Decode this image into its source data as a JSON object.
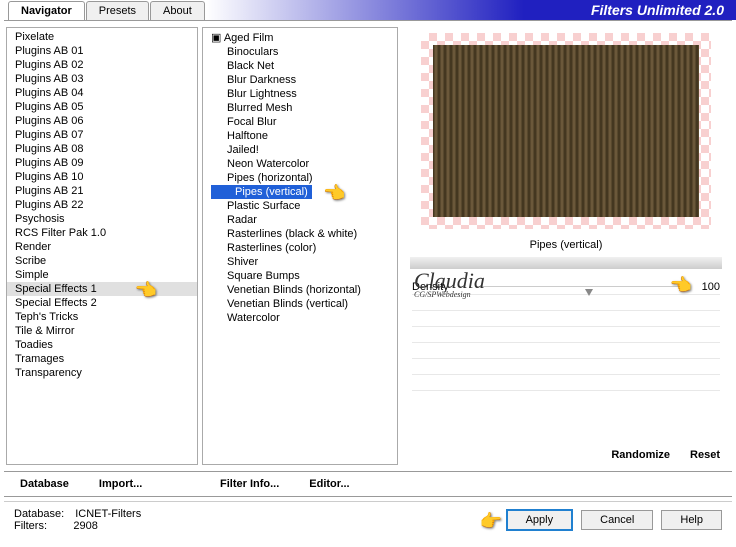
{
  "app_title": "Filters Unlimited 2.0",
  "tabs": [
    "Navigator",
    "Presets",
    "About"
  ],
  "active_tab": 0,
  "categories": [
    "Pixelate",
    "Plugins AB 01",
    "Plugins AB 02",
    "Plugins AB 03",
    "Plugins AB 04",
    "Plugins AB 05",
    "Plugins AB 06",
    "Plugins AB 07",
    "Plugins AB 08",
    "Plugins AB 09",
    "Plugins AB 10",
    "Plugins AB 21",
    "Plugins AB 22",
    "Psychosis",
    "RCS Filter Pak 1.0",
    "Render",
    "Scribe",
    "Simple",
    "Special Effects 1",
    "Special Effects 2",
    "Teph's Tricks",
    "Tile & Mirror",
    "Toadies",
    "Tramages",
    "Transparency"
  ],
  "selected_category_index": 18,
  "filters_header": "Aged Film",
  "filters": [
    "Binoculars",
    "Black Net",
    "Blur Darkness",
    "Blur Lightness",
    "Blurred Mesh",
    "Focal Blur",
    "Halftone",
    "Jailed!",
    "Neon Watercolor",
    "Pipes (horizontal)",
    "Pipes (vertical)",
    "Plastic Surface",
    "Radar",
    "Rasterlines (black & white)",
    "Rasterlines (color)",
    "Shiver",
    "Square Bumps",
    "Venetian Blinds (horizontal)",
    "Venetian Blinds (vertical)",
    "Watercolor"
  ],
  "selected_filter_index": 10,
  "preview_label": "Pipes (vertical)",
  "param": {
    "label": "Density",
    "value": "100"
  },
  "col1_buttons": [
    "Database",
    "Import..."
  ],
  "col2_buttons": [
    "Filter Info...",
    "Editor..."
  ],
  "col3_buttons": [
    "Randomize",
    "Reset"
  ],
  "footer": {
    "db_label": "Database:",
    "db_value": "ICNET-Filters",
    "filters_label": "Filters:",
    "filters_value": "2908"
  },
  "footer_buttons": {
    "apply": "Apply",
    "cancel": "Cancel",
    "help": "Help"
  },
  "watermark": {
    "name": "Claudia",
    "sub": "CG/SPWebdesign"
  }
}
